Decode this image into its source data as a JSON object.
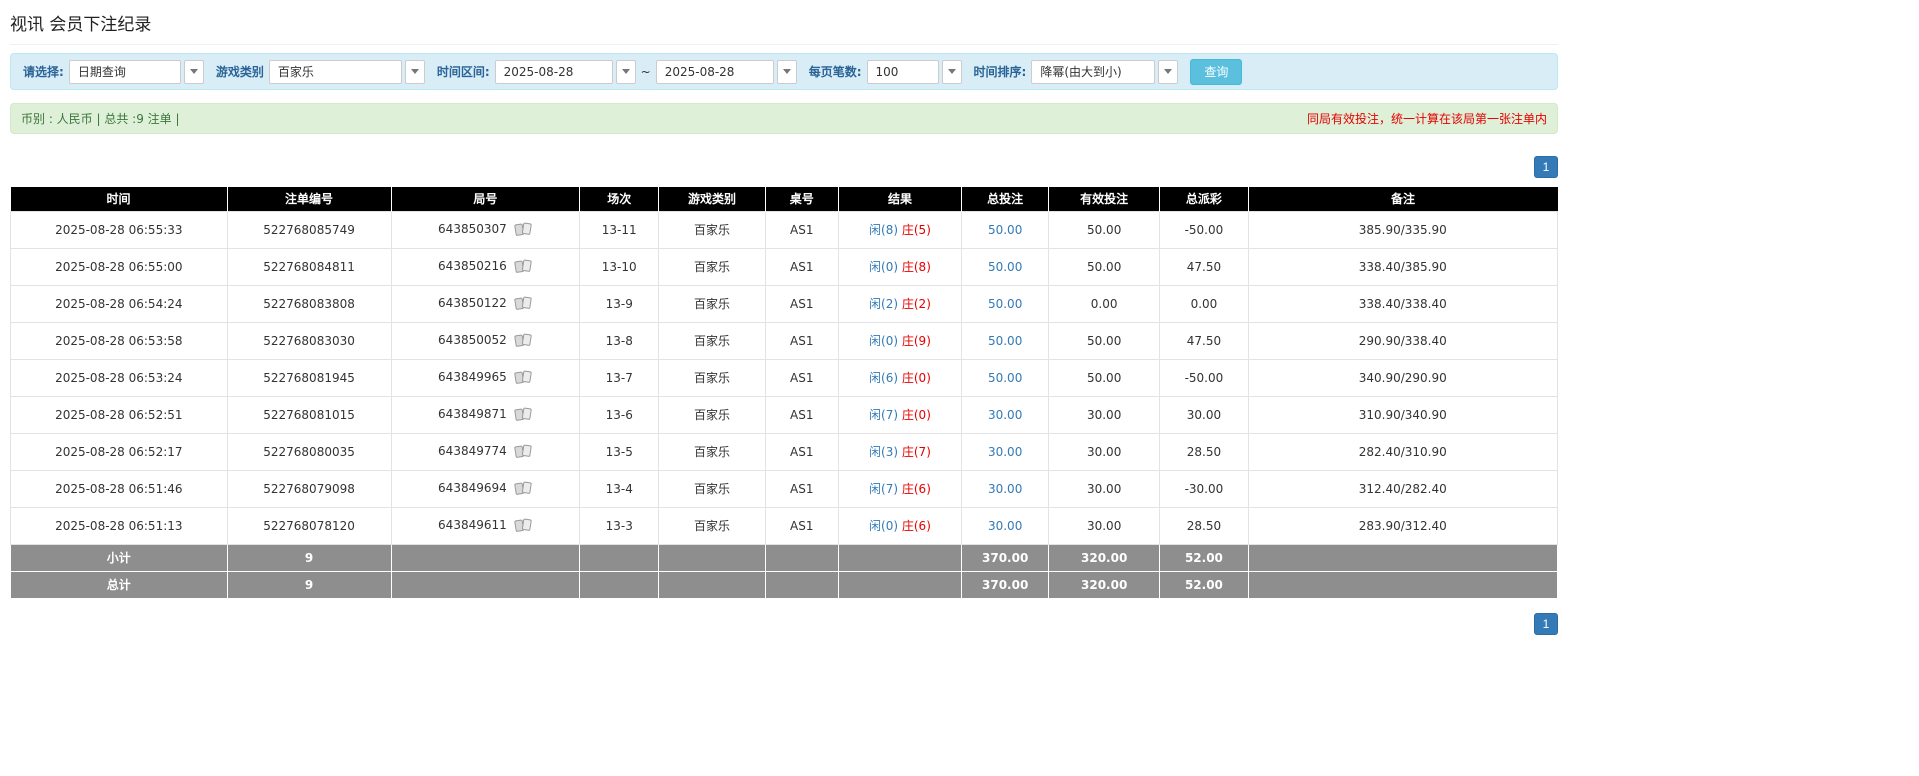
{
  "page": {
    "title": "视讯 会员下注纪录"
  },
  "filter": {
    "select_label": "请选择:",
    "select_value": "日期查询",
    "game_type_label": "游戏类别",
    "game_type_value": "百家乐",
    "date_range_label": "时间区间:",
    "date_from": "2025-08-28",
    "date_separator": "~",
    "date_to": "2025-08-28",
    "page_size_label": "每页笔数:",
    "page_size_value": "100",
    "sort_label": "时间排序:",
    "sort_value": "降幂(由大到小)",
    "search_button_label": "查询"
  },
  "info_bar": {
    "summary_text": "币别 : 人民币 | 总共 :9 注单 |",
    "notice_text": "同局有效投注，统一计算在该局第一张注单内"
  },
  "pagination": {
    "current_page": "1"
  },
  "table": {
    "headers": [
      "时间",
      "注单编号",
      "局号",
      "场次",
      "游戏类别",
      "桌号",
      "结果",
      "总投注",
      "有效投注",
      "总派彩",
      "备注"
    ],
    "rows": [
      {
        "time": "2025-08-28 06:55:33",
        "bet_id": "522768085749",
        "round_id": "643850307",
        "session": "13-11",
        "game_type": "百家乐",
        "table_no": "AS1",
        "result_player": "闲(8)",
        "result_banker": "庄(5)",
        "total_bet": "50.00",
        "valid_bet": "50.00",
        "payout": "-50.00",
        "note": "385.90/335.90"
      },
      {
        "time": "2025-08-28 06:55:00",
        "bet_id": "522768084811",
        "round_id": "643850216",
        "session": "13-10",
        "game_type": "百家乐",
        "table_no": "AS1",
        "result_player": "闲(0)",
        "result_banker": "庄(8)",
        "total_bet": "50.00",
        "valid_bet": "50.00",
        "payout": "47.50",
        "note": "338.40/385.90"
      },
      {
        "time": "2025-08-28 06:54:24",
        "bet_id": "522768083808",
        "round_id": "643850122",
        "session": "13-9",
        "game_type": "百家乐",
        "table_no": "AS1",
        "result_player": "闲(2)",
        "result_banker": "庄(2)",
        "total_bet": "50.00",
        "valid_bet": "0.00",
        "payout": "0.00",
        "note": "338.40/338.40"
      },
      {
        "time": "2025-08-28 06:53:58",
        "bet_id": "522768083030",
        "round_id": "643850052",
        "session": "13-8",
        "game_type": "百家乐",
        "table_no": "AS1",
        "result_player": "闲(0)",
        "result_banker": "庄(9)",
        "total_bet": "50.00",
        "valid_bet": "50.00",
        "payout": "47.50",
        "note": "290.90/338.40"
      },
      {
        "time": "2025-08-28 06:53:24",
        "bet_id": "522768081945",
        "round_id": "643849965",
        "session": "13-7",
        "game_type": "百家乐",
        "table_no": "AS1",
        "result_player": "闲(6)",
        "result_banker": "庄(0)",
        "total_bet": "50.00",
        "valid_bet": "50.00",
        "payout": "-50.00",
        "note": "340.90/290.90"
      },
      {
        "time": "2025-08-28 06:52:51",
        "bet_id": "522768081015",
        "round_id": "643849871",
        "session": "13-6",
        "game_type": "百家乐",
        "table_no": "AS1",
        "result_player": "闲(7)",
        "result_banker": "庄(0)",
        "total_bet": "30.00",
        "valid_bet": "30.00",
        "payout": "30.00",
        "note": "310.90/340.90"
      },
      {
        "time": "2025-08-28 06:52:17",
        "bet_id": "522768080035",
        "round_id": "643849774",
        "session": "13-5",
        "game_type": "百家乐",
        "table_no": "AS1",
        "result_player": "闲(3)",
        "result_banker": "庄(7)",
        "total_bet": "30.00",
        "valid_bet": "30.00",
        "payout": "28.50",
        "note": "282.40/310.90"
      },
      {
        "time": "2025-08-28 06:51:46",
        "bet_id": "522768079098",
        "round_id": "643849694",
        "session": "13-4",
        "game_type": "百家乐",
        "table_no": "AS1",
        "result_player": "闲(7)",
        "result_banker": "庄(6)",
        "total_bet": "30.00",
        "valid_bet": "30.00",
        "payout": "-30.00",
        "note": "312.40/282.40"
      },
      {
        "time": "2025-08-28 06:51:13",
        "bet_id": "522768078120",
        "round_id": "643849611",
        "session": "13-3",
        "game_type": "百家乐",
        "table_no": "AS1",
        "result_player": "闲(0)",
        "result_banker": "庄(6)",
        "total_bet": "30.00",
        "valid_bet": "30.00",
        "payout": "28.50",
        "note": "283.90/312.40"
      }
    ],
    "subtotal": {
      "label": "小计",
      "count": "9",
      "total_bet": "370.00",
      "valid_bet": "320.00",
      "payout": "52.00"
    },
    "total": {
      "label": "总计",
      "count": "9",
      "total_bet": "370.00",
      "valid_bet": "320.00",
      "payout": "52.00"
    }
  },
  "colors": {
    "accent_blue": "#337ab7",
    "negative_red": "#e60000",
    "result_player_blue": "#337ab7",
    "result_banker_red": "#e60000",
    "table_header_bg": "#000000",
    "summary_row_bg": "#8e8e8e",
    "filter_bar_bg": "#d9edf7",
    "info_bar_bg": "#dff0d8",
    "search_button_bg": "#5bc0de",
    "pagination_bg": "#337ab7"
  },
  "icons": {
    "round_cell_icon": "view-cards-icon",
    "dropdown_icon": "chevron-down-icon"
  }
}
